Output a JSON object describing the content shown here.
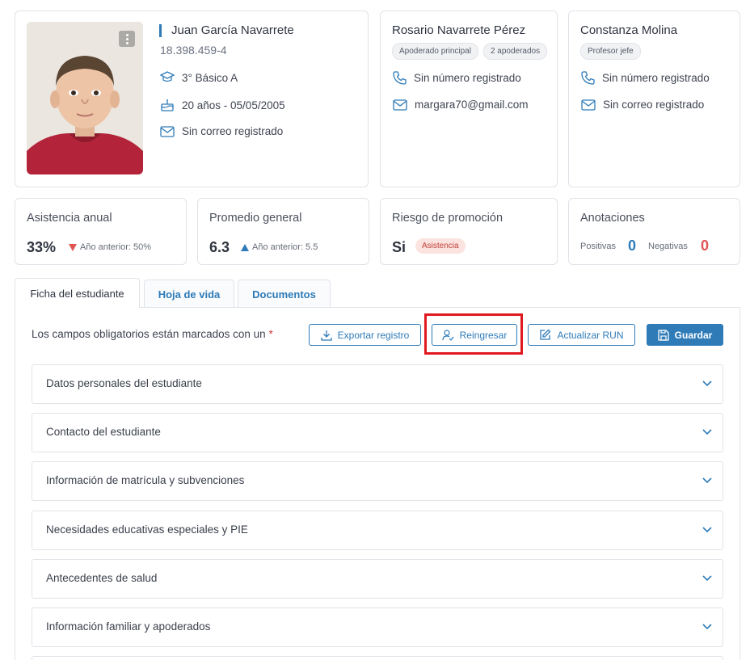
{
  "student": {
    "name": "Juan García Navarrete",
    "rut": "18.398.459-4",
    "course": "3° Básico A",
    "age_birth": "20 años - 05/05/2005",
    "email": "Sin correo registrado"
  },
  "guardian": {
    "name": "Rosario Navarrete Pérez",
    "chips": [
      "Apoderado principal",
      "2 apoderados"
    ],
    "phone": "Sin número registrado",
    "email": "margara70@gmail.com"
  },
  "teacher": {
    "name": "Constanza Molina",
    "chip": "Profesor jefe",
    "phone": "Sin número registrado",
    "email": "Sin correo registrado"
  },
  "stats": {
    "attendance": {
      "title": "Asistencia anual",
      "value": "33%",
      "note": "Año anterior: 50%",
      "trend": "down"
    },
    "average": {
      "title": "Promedio general",
      "value": "6.3",
      "note": "Año anterior: 5.5",
      "trend": "up"
    },
    "risk": {
      "title": "Riesgo de promoción",
      "value": "Si",
      "badge": "Asistencia"
    },
    "notes": {
      "title": "Anotaciones",
      "positive_label": "Positivas",
      "positive_value": "0",
      "negative_label": "Negativas",
      "negative_value": "0"
    }
  },
  "tabs": [
    "Ficha del estudiante",
    "Hoja de vida",
    "Documentos"
  ],
  "form": {
    "required_note": "Los campos obligatorios están marcados con un",
    "required_mark": "*"
  },
  "actions": {
    "export": "Exportar registro",
    "reenroll": "Reingresar",
    "update_run": "Actualizar RUN",
    "save": "Guardar"
  },
  "sections": [
    "Datos personales del estudiante",
    "Contacto del estudiante",
    "Información de matrícula y subvenciones",
    "Necesidades educativas especiales y PIE",
    "Antecedentes de salud",
    "Información familiar y apoderados"
  ],
  "colors": {
    "accent": "#2e7bb8",
    "danger": "#e05454",
    "highlight": "#e0191f"
  }
}
